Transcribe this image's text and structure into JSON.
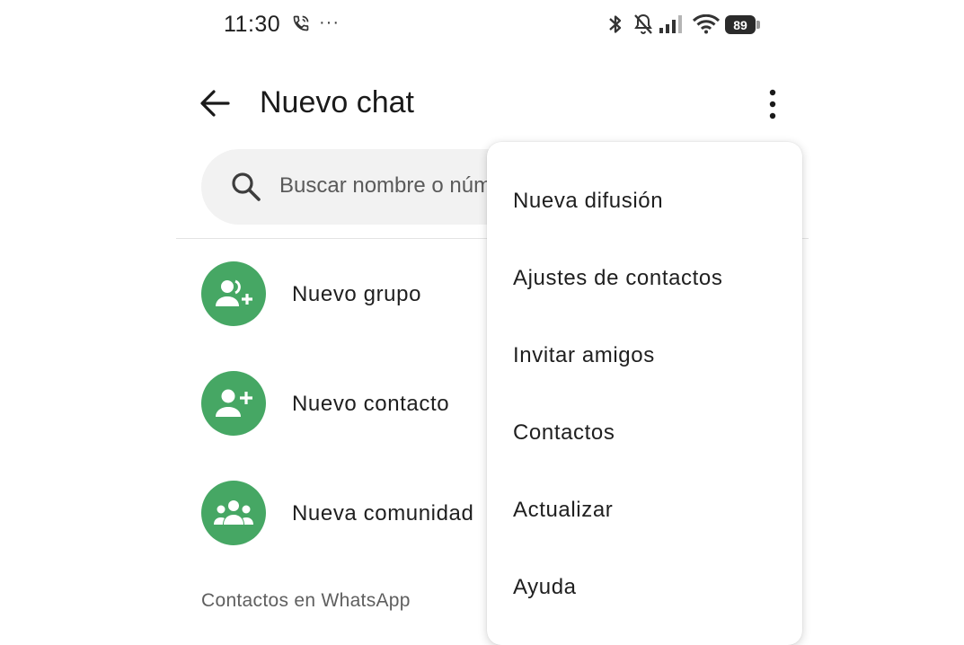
{
  "status_bar": {
    "time": "11:30",
    "overflow": "···",
    "battery": "89",
    "icons": [
      "phone-call-icon",
      "bluetooth-icon",
      "bell-off-icon",
      "signal-icon",
      "wifi-icon",
      "battery-icon"
    ]
  },
  "header": {
    "title": "Nuevo chat",
    "back_icon": "arrow-left-icon",
    "menu_icon": "kebab-menu-icon"
  },
  "search": {
    "placeholder": "Buscar nombre o núm"
  },
  "actions": [
    {
      "label": "Nuevo grupo",
      "icon": "group-add-icon"
    },
    {
      "label": "Nuevo contacto",
      "icon": "person-add-icon"
    },
    {
      "label": "Nueva comunidad",
      "icon": "community-icon"
    }
  ],
  "section_header": "Contactos en WhatsApp",
  "menu": {
    "items": [
      "Nueva difusión",
      "Ajustes de contactos",
      "Invitar amigos",
      "Contactos",
      "Actualizar",
      "Ayuda"
    ]
  },
  "colors": {
    "accent": "#46a764",
    "search_bg": "#f2f2f2",
    "text": "#1f1f1f"
  }
}
